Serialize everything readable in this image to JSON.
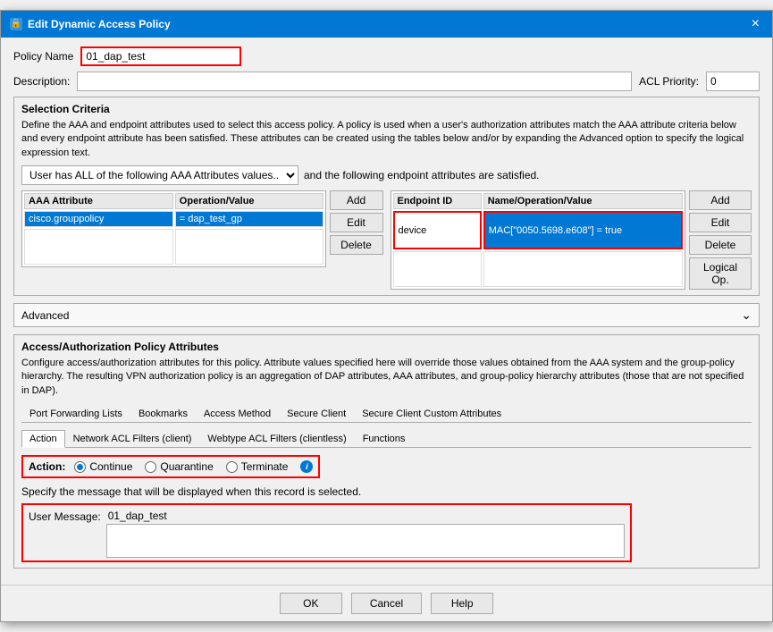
{
  "dialog": {
    "title": "Edit Dynamic Access Policy",
    "close_label": "×"
  },
  "form": {
    "policy_name_label": "Policy Name",
    "policy_name_value": "01_dap_test",
    "description_label": "Description:",
    "acl_priority_label": "ACL Priority:",
    "acl_priority_value": "0"
  },
  "selection_criteria": {
    "title": "Selection Criteria",
    "description": "Define the AAA and endpoint attributes used to select this access policy. A policy is used when a user's authorization attributes match the AAA attribute criteria below and every endpoint attribute has been satisfied. These attributes can be created using the tables below and/or by expanding the Advanced option to specify the logical expression text.",
    "dropdown_value": "User has ALL of the following AAA Attributes values...",
    "and_text": "and the following endpoint attributes are satisfied.",
    "aaa_table": {
      "col1": "AAA Attribute",
      "col2": "Operation/Value",
      "rows": [
        {
          "col1": "cisco.grouppolicy",
          "col2": "= dap_test_gp",
          "selected": true
        }
      ]
    },
    "endpoint_table": {
      "col1": "Endpoint ID",
      "col2": "Name/Operation/Value",
      "rows": [
        {
          "col1": "device",
          "col2": "MAC[\"0050.5698.e608\"] = true",
          "selected": true
        }
      ]
    },
    "buttons": {
      "add": "Add",
      "edit": "Edit",
      "delete": "Delete",
      "logical_op": "Logical Op."
    }
  },
  "advanced": {
    "label": "Advanced"
  },
  "access_section": {
    "title": "Access/Authorization Policy Attributes",
    "description": "Configure access/authorization attributes for this policy. Attribute values specified here will override those values obtained from the AAA system and the group-policy hierarchy. The resulting VPN authorization policy is an aggregation of DAP attributes, AAA attributes, and group-policy hierarchy attributes (those that are not specified in DAP).",
    "tabs": [
      {
        "label": "Port Forwarding Lists",
        "active": false
      },
      {
        "label": "Bookmarks",
        "active": false
      },
      {
        "label": "Access Method",
        "active": false
      },
      {
        "label": "Secure Client",
        "active": false
      },
      {
        "label": "Secure Client Custom Attributes",
        "active": false
      }
    ],
    "tab_row2": [
      {
        "label": "Action",
        "active": true
      },
      {
        "label": "Network ACL Filters (client)",
        "active": false
      },
      {
        "label": "Webtype ACL Filters (clientless)",
        "active": false
      },
      {
        "label": "Functions",
        "active": false
      }
    ],
    "action_label": "Action:",
    "radio_options": [
      {
        "label": "Continue",
        "value": "continue",
        "selected": true
      },
      {
        "label": "Quarantine",
        "value": "quarantine",
        "selected": false
      },
      {
        "label": "Terminate",
        "value": "terminate",
        "selected": false
      }
    ],
    "message_desc": "Specify the message that will be displayed when this record is selected.",
    "user_message_label": "User Message:",
    "user_message_value": "01_dap_test"
  },
  "footer": {
    "ok": "OK",
    "cancel": "Cancel",
    "help": "Help"
  }
}
